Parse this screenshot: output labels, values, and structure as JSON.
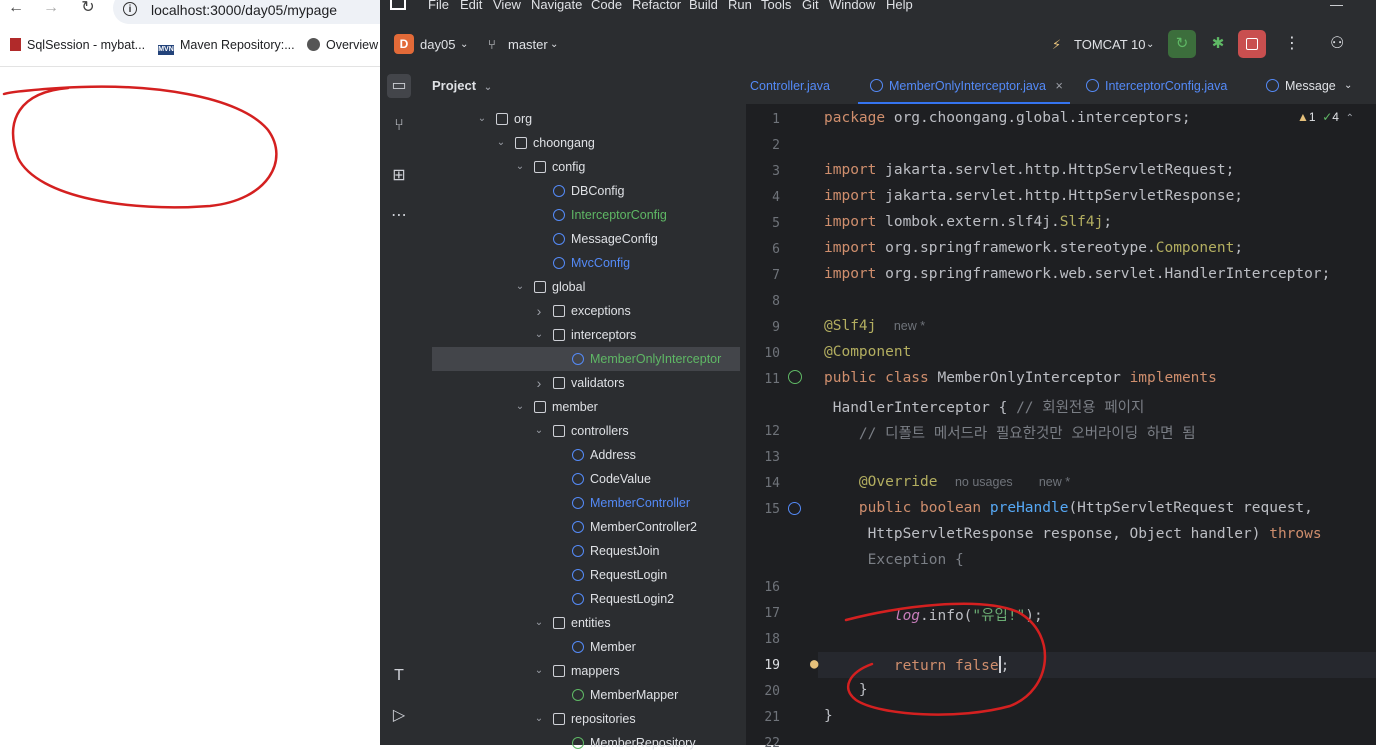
{
  "browser": {
    "url": "localhost:3000/day05/mypage",
    "bookmarks": [
      "SqlSession - mybat...",
      "Maven Repository:...",
      "Overview"
    ]
  },
  "ide": {
    "menu": [
      "File",
      "Edit",
      "View",
      "Navigate",
      "Code",
      "Refactor",
      "Build",
      "Run",
      "Tools",
      "Git",
      "Window",
      "Help"
    ],
    "project_badge": "D",
    "project_name": "day05",
    "branch": "master",
    "run_config": "TOMCAT 10",
    "project_panel_title": "Project",
    "tree": [
      {
        "label": "org",
        "type": "folder",
        "depth": 0,
        "arrow": "down"
      },
      {
        "label": "choongang",
        "type": "folder",
        "depth": 1,
        "arrow": "down"
      },
      {
        "label": "config",
        "type": "folder",
        "depth": 2,
        "arrow": "down"
      },
      {
        "label": "DBConfig",
        "type": "class",
        "depth": 3,
        "color": "default"
      },
      {
        "label": "InterceptorConfig",
        "type": "class",
        "depth": 3,
        "color": "green"
      },
      {
        "label": "MessageConfig",
        "type": "class",
        "depth": 3,
        "color": "default"
      },
      {
        "label": "MvcConfig",
        "type": "class",
        "depth": 3,
        "color": "blue"
      },
      {
        "label": "global",
        "type": "folder",
        "depth": 2,
        "arrow": "down"
      },
      {
        "label": "exceptions",
        "type": "folder",
        "depth": 3,
        "arrow": "right"
      },
      {
        "label": "interceptors",
        "type": "folder",
        "depth": 3,
        "arrow": "down"
      },
      {
        "label": "MemberOnlyInterceptor",
        "type": "class",
        "depth": 4,
        "color": "green",
        "selected": true
      },
      {
        "label": "validators",
        "type": "folder",
        "depth": 3,
        "arrow": "right"
      },
      {
        "label": "member",
        "type": "folder",
        "depth": 2,
        "arrow": "down"
      },
      {
        "label": "controllers",
        "type": "folder",
        "depth": 3,
        "arrow": "down"
      },
      {
        "label": "Address",
        "type": "class",
        "depth": 4,
        "color": "default"
      },
      {
        "label": "CodeValue",
        "type": "class",
        "depth": 4,
        "color": "default"
      },
      {
        "label": "MemberController",
        "type": "class",
        "depth": 4,
        "color": "blue"
      },
      {
        "label": "MemberController2",
        "type": "class",
        "depth": 4,
        "color": "default"
      },
      {
        "label": "RequestJoin",
        "type": "class",
        "depth": 4,
        "color": "default"
      },
      {
        "label": "RequestLogin",
        "type": "class",
        "depth": 4,
        "color": "default"
      },
      {
        "label": "RequestLogin2",
        "type": "class",
        "depth": 4,
        "color": "default"
      },
      {
        "label": "entities",
        "type": "folder",
        "depth": 3,
        "arrow": "down"
      },
      {
        "label": "Member",
        "type": "class",
        "depth": 4,
        "color": "default"
      },
      {
        "label": "mappers",
        "type": "folder",
        "depth": 3,
        "arrow": "down"
      },
      {
        "label": "MemberMapper",
        "type": "interface",
        "depth": 4,
        "color": "default"
      },
      {
        "label": "repositories",
        "type": "folder",
        "depth": 3,
        "arrow": "down"
      },
      {
        "label": "MemberRepository",
        "type": "interface",
        "depth": 4,
        "color": "default"
      }
    ],
    "tabs": [
      "Controller.java",
      "MemberOnlyInterceptor.java",
      "InterceptorConfig.java",
      "Message"
    ],
    "tab_close": "×",
    "inspections": {
      "warnings": "1",
      "checks": "4"
    },
    "line_numbers": [
      "1",
      "2",
      "3",
      "4",
      "5",
      "6",
      "7",
      "8",
      "9",
      "10",
      "11",
      "12",
      "13",
      "14",
      "15",
      "16",
      "17",
      "18",
      "19",
      "20",
      "21",
      "22"
    ],
    "code": {
      "l1_kw": "package ",
      "l1_rest": "org.choongang.global.interceptors;",
      "l3": "jakarta.servlet.http.HttpServletRequest;",
      "l4": "jakarta.servlet.http.HttpServletResponse;",
      "l5a": "lombok.extern.slf4j.",
      "l5b": "Slf4j",
      "l6a": "org.springframework.stereotype.",
      "l6b": "Component",
      "l7": "org.springframework.web.servlet.HandlerInterceptor;",
      "import_kw": "import ",
      "l9": "@Slf4j",
      "l9_hint": "new *",
      "l10": "@Component",
      "l11_kw1": "public class ",
      "l11_name": "MemberOnlyInterceptor ",
      "l11_kw2": "implements",
      "l11b": " HandlerInterceptor { ",
      "l11b_cm": "// 회원전용 페이지",
      "l11c_cm": "    // 디폴트 메서드라 필요한것만 오버라이딩 하면 됨",
      "l14": "    @Override",
      "l14_hint1": "no usages",
      "l14_hint2": "new *",
      "l15_kw": "    public boolean ",
      "l15_fn": "preHandle",
      "l15_rest": "(HttpServletRequest request,",
      "l15b": "     HttpServletResponse response, Object handler) ",
      "l15b_kw": "throws",
      "l15c": "     Exception {",
      "l17_log": "        log",
      "l17_mid": ".info(",
      "l17_str": "\"유입!\"",
      "l17_end": ");",
      "l19_kw": "        return false",
      "l19_end": ";",
      "l20": "    }",
      "l21": "}"
    }
  }
}
